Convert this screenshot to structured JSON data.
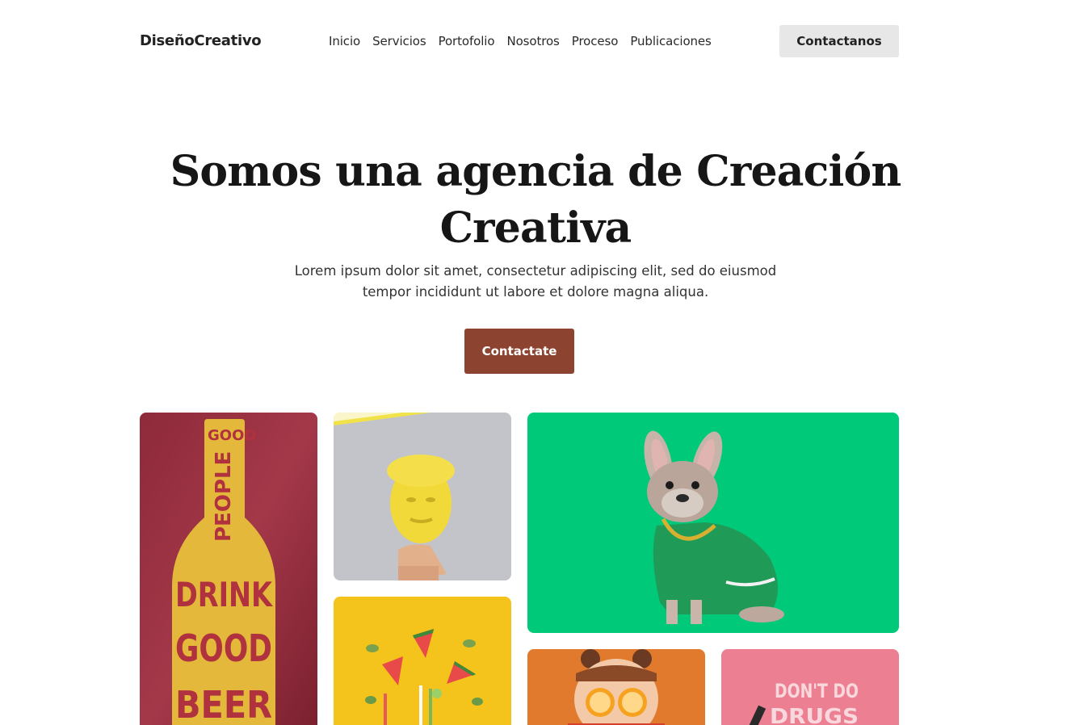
{
  "brand": "DiseñoCreativo",
  "nav": {
    "items": [
      "Inicio",
      "Servicios",
      "Portofolio",
      "Nosotros",
      "Proceso",
      "Publicaciones"
    ],
    "cta_label": "Contactanos"
  },
  "hero": {
    "title_line1": "Somos una agencia de Creación",
    "title_line2": "Creativa",
    "subtitle_line1": "Lorem ipsum dolor sit amet, consectetur adipiscing elit, sed do eiusmod",
    "subtitle_line2": "tempor incididunt ut labore et dolore magna aliqua.",
    "cta_label": "Contactate"
  },
  "gallery": {
    "beer_text": [
      "GOOD",
      "PEOPLE",
      "DRINK",
      "GOOD",
      "BEER"
    ],
    "sign_text": [
      "DON'T DO",
      "DRUGS"
    ]
  },
  "colors": {
    "accent": "#8c4330",
    "nav_button": "#e7e7e7",
    "dog_bg": "#00c97a",
    "melon_bg": "#f4c41c",
    "pink_bg": "#ec7f92"
  }
}
